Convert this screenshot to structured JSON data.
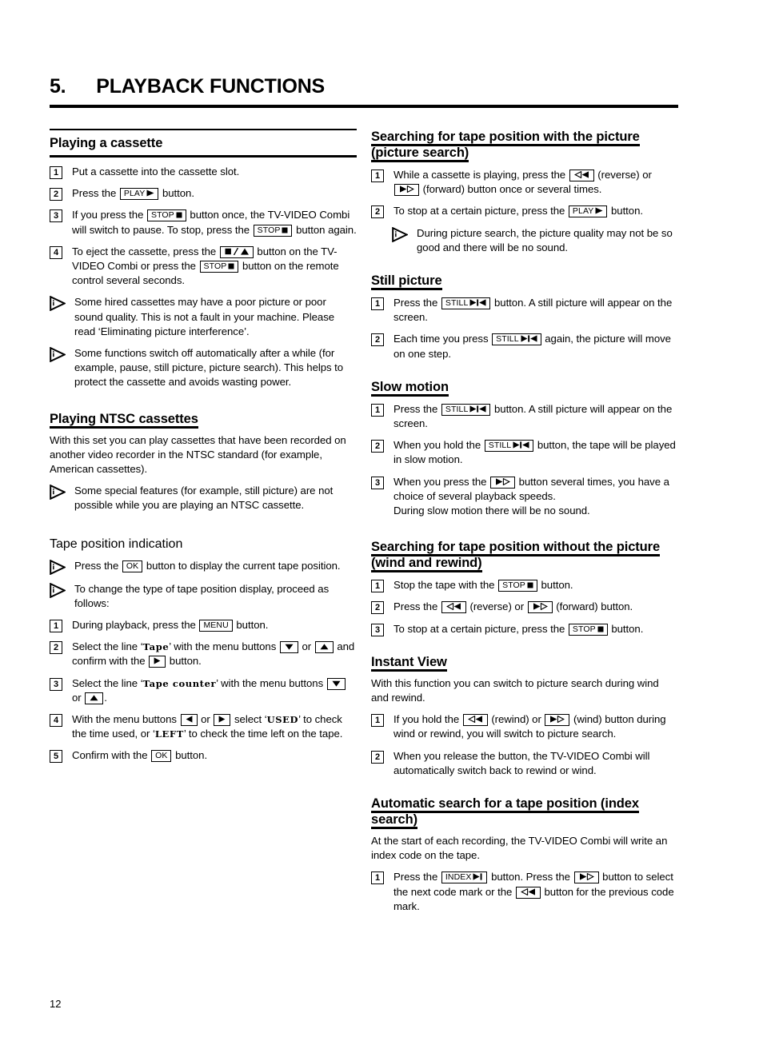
{
  "chapter": {
    "number": "5.",
    "title": "PLAYBACK FUNCTIONS"
  },
  "folio": "12",
  "keys": {
    "play": "PLAY",
    "stop": "STOP",
    "still": "STILL",
    "index": "INDEX",
    "ok": "OK",
    "menu": "MENU",
    "eject_left": "",
    "reverse": "",
    "forward": ""
  },
  "left_column": {
    "section_playing_cassette": {
      "title": "Playing a cassette",
      "steps": [
        {
          "num": "1",
          "parts": [
            {
              "t": "text",
              "v": "Put a cassette into the cassette slot."
            }
          ]
        },
        {
          "num": "2",
          "parts": [
            {
              "t": "text",
              "v": "Press the "
            },
            {
              "t": "key",
              "label": "PLAY",
              "glyph": "play-right"
            },
            {
              "t": "text",
              "v": " button."
            }
          ]
        },
        {
          "num": "3",
          "parts": [
            {
              "t": "text",
              "v": "If you press the "
            },
            {
              "t": "key",
              "label": "STOP",
              "glyph": "stop-square"
            },
            {
              "t": "text",
              "v": " button once, the TV-VIDEO Combi will switch to pause. To stop, press the "
            },
            {
              "t": "key",
              "label": "STOP",
              "glyph": "stop-square"
            },
            {
              "t": "text",
              "v": " button again."
            }
          ]
        },
        {
          "num": "4",
          "parts": [
            {
              "t": "text",
              "v": "To eject the cassette, press the "
            },
            {
              "t": "key",
              "label": "",
              "glyph": "eject-combo"
            },
            {
              "t": "text",
              "v": " button on the TV-VIDEO Combi or press the "
            },
            {
              "t": "key",
              "label": "STOP",
              "glyph": "stop-square"
            },
            {
              "t": "text",
              "v": " button on the remote control several seconds."
            }
          ]
        }
      ],
      "notes": [
        "Some hired cassettes may have a poor picture or poor sound quality. This is not a fault in your machine. Please read ‘Eliminating picture interference’.",
        "Some functions switch off automatically after a while (for example, pause, still picture, picture search). This helps to protect the cassette and avoids wasting power."
      ]
    },
    "section_ntsc": {
      "title": "Playing NTSC cassettes",
      "intro": "With this set you can play cassettes that have been recorded on another video recorder in the NTSC standard (for example, American cassettes).",
      "notes": [
        "Some special features (for example, still picture) are not possible while you are playing an NTSC cassette."
      ]
    },
    "section_tape_position": {
      "title": "Tape position indication",
      "notes": [
        {
          "parts": [
            {
              "t": "text",
              "v": "Press the "
            },
            {
              "t": "key",
              "label": "OK",
              "glyph": ""
            },
            {
              "t": "text",
              "v": " button to display the current tape position."
            }
          ]
        },
        {
          "parts": [
            {
              "t": "text",
              "v": "To change the type of tape position display, proceed as follows:"
            }
          ]
        }
      ],
      "steps": [
        {
          "num": "1",
          "parts": [
            {
              "t": "text",
              "v": "During playback, press the "
            },
            {
              "t": "key",
              "label": "MENU",
              "glyph": ""
            },
            {
              "t": "text",
              "v": " button."
            }
          ]
        },
        {
          "num": "2",
          "parts": [
            {
              "t": "text",
              "v": "Select the line ‘"
            },
            {
              "t": "osd",
              "v": "Tape"
            },
            {
              "t": "text",
              "v": "’ with the menu buttons "
            },
            {
              "t": "key",
              "label": "",
              "glyph": "arrow-down"
            },
            {
              "t": "text",
              "v": " or "
            },
            {
              "t": "key",
              "label": "",
              "glyph": "arrow-up"
            },
            {
              "t": "text",
              "v": " and confirm with the "
            },
            {
              "t": "key",
              "label": "",
              "glyph": "arrow-right"
            },
            {
              "t": "text",
              "v": " button."
            }
          ]
        },
        {
          "num": "3",
          "parts": [
            {
              "t": "text",
              "v": "Select the line ‘"
            },
            {
              "t": "osd",
              "v": "Tape  counter"
            },
            {
              "t": "text",
              "v": "’ with the menu buttons "
            },
            {
              "t": "key",
              "label": "",
              "glyph": "arrow-down"
            },
            {
              "t": "text",
              "v": " or "
            },
            {
              "t": "key",
              "label": "",
              "glyph": "arrow-up"
            },
            {
              "t": "text",
              "v": "."
            }
          ]
        },
        {
          "num": "4",
          "parts": [
            {
              "t": "text",
              "v": "With the menu buttons "
            },
            {
              "t": "key",
              "label": "",
              "glyph": "arrow-left"
            },
            {
              "t": "text",
              "v": " or "
            },
            {
              "t": "key",
              "label": "",
              "glyph": "arrow-right"
            },
            {
              "t": "text",
              "v": " select ‘"
            },
            {
              "t": "osd",
              "v": "USED"
            },
            {
              "t": "text",
              "v": "’ to check the time used, or ‘"
            },
            {
              "t": "osd",
              "v": "LEFT"
            },
            {
              "t": "text",
              "v": "’ to check the time left on the tape."
            }
          ]
        },
        {
          "num": "5",
          "parts": [
            {
              "t": "text",
              "v": "Confirm with the "
            },
            {
              "t": "key",
              "label": "OK",
              "glyph": ""
            },
            {
              "t": "text",
              "v": " button."
            }
          ]
        }
      ]
    }
  },
  "right_column": {
    "section_picture_search": {
      "title": "Searching for tape position with the picture (picture search)",
      "steps": [
        {
          "num": "1",
          "parts": [
            {
              "t": "text",
              "v": "While a cassette is playing, press the "
            },
            {
              "t": "key",
              "label": "",
              "glyph": "rewind"
            },
            {
              "t": "text",
              "v": " (reverse) or "
            },
            {
              "t": "key",
              "label": "",
              "glyph": "wind"
            },
            {
              "t": "text",
              "v": " (forward) button once or several times."
            }
          ]
        },
        {
          "num": "2",
          "parts": [
            {
              "t": "text",
              "v": "To stop at a certain picture, press the "
            },
            {
              "t": "key",
              "label": "PLAY",
              "glyph": "play-right"
            },
            {
              "t": "text",
              "v": " button."
            }
          ]
        }
      ],
      "notes": [
        "During picture search, the picture quality may not be so good and there will be no sound."
      ]
    },
    "section_still_picture": {
      "title": "Still picture",
      "steps": [
        {
          "num": "1",
          "parts": [
            {
              "t": "text",
              "v": "Press the "
            },
            {
              "t": "key",
              "label": "STILL",
              "glyph": "still"
            },
            {
              "t": "text",
              "v": " button. A still picture will appear on the screen."
            }
          ]
        },
        {
          "num": "2",
          "parts": [
            {
              "t": "text",
              "v": "Each time you press "
            },
            {
              "t": "key",
              "label": "STILL",
              "glyph": "still"
            },
            {
              "t": "text",
              "v": " again, the picture will move on one step."
            }
          ]
        }
      ]
    },
    "section_slow_motion": {
      "title": "Slow motion",
      "steps": [
        {
          "num": "1",
          "parts": [
            {
              "t": "text",
              "v": "Press the "
            },
            {
              "t": "key",
              "label": "STILL",
              "glyph": "still"
            },
            {
              "t": "text",
              "v": " button. A still picture will appear on the screen."
            }
          ]
        },
        {
          "num": "2",
          "parts": [
            {
              "t": "text",
              "v": "When you hold the "
            },
            {
              "t": "key",
              "label": "STILL",
              "glyph": "still"
            },
            {
              "t": "text",
              "v": " button, the tape will be played in slow motion."
            }
          ]
        },
        {
          "num": "3",
          "parts": [
            {
              "t": "text",
              "v": "When you press the "
            },
            {
              "t": "key",
              "label": "",
              "glyph": "wind"
            },
            {
              "t": "text",
              "v": " button several times, you have a choice of several playback speeds."
            },
            {
              "t": "br"
            },
            {
              "t": "text",
              "v": "During slow motion there will be no sound."
            }
          ]
        }
      ]
    },
    "section_wind_rewind": {
      "title": "Searching for tape position without the picture (wind and rewind)",
      "steps": [
        {
          "num": "1",
          "parts": [
            {
              "t": "text",
              "v": "Stop the tape with the "
            },
            {
              "t": "key",
              "label": "STOP",
              "glyph": "stop-square"
            },
            {
              "t": "text",
              "v": " button."
            }
          ]
        },
        {
          "num": "2",
          "parts": [
            {
              "t": "text",
              "v": "Press the "
            },
            {
              "t": "key",
              "label": "",
              "glyph": "rewind"
            },
            {
              "t": "text",
              "v": " (reverse) or "
            },
            {
              "t": "key",
              "label": "",
              "glyph": "wind"
            },
            {
              "t": "text",
              "v": " (forward) button."
            }
          ]
        },
        {
          "num": "3",
          "parts": [
            {
              "t": "text",
              "v": "To stop at a certain picture, press the "
            },
            {
              "t": "key",
              "label": "STOP",
              "glyph": "stop-square"
            },
            {
              "t": "text",
              "v": " button."
            }
          ]
        }
      ]
    },
    "section_instant_view": {
      "title": "Instant View",
      "intro": "With this function you can switch to picture search during wind and rewind.",
      "steps": [
        {
          "num": "1",
          "parts": [
            {
              "t": "text",
              "v": "If you hold the "
            },
            {
              "t": "key",
              "label": "",
              "glyph": "rewind"
            },
            {
              "t": "text",
              "v": " (rewind) or "
            },
            {
              "t": "key",
              "label": "",
              "glyph": "wind"
            },
            {
              "t": "text",
              "v": " (wind) button during wind or rewind, you will switch to picture search."
            }
          ]
        },
        {
          "num": "2",
          "parts": [
            {
              "t": "text",
              "v": "When you release the button, the TV-VIDEO Combi will automatically switch back to rewind or wind."
            }
          ]
        }
      ]
    },
    "section_index_search": {
      "title": "Automatic search for a tape position (index search)",
      "intro": "At the start of each recording, the TV-VIDEO Combi will write an index code on the tape.",
      "steps": [
        {
          "num": "1",
          "parts": [
            {
              "t": "text",
              "v": "Press the "
            },
            {
              "t": "key",
              "label": "INDEX",
              "glyph": "index"
            },
            {
              "t": "text",
              "v": " button. Press the "
            },
            {
              "t": "key",
              "label": "",
              "glyph": "wind"
            },
            {
              "t": "text",
              "v": " button to select the next code mark or the "
            },
            {
              "t": "key",
              "label": "",
              "glyph": "rewind"
            },
            {
              "t": "text",
              "v": " button for the previous code mark."
            }
          ]
        }
      ]
    }
  }
}
